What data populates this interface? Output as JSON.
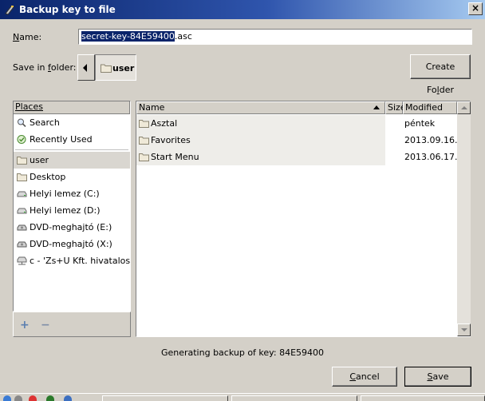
{
  "window": {
    "title": "Backup key to file",
    "close_glyph": "×"
  },
  "name_label_pre": "N",
  "name_label_post": "ame:",
  "filename": {
    "selected": "secret-key-84E59400",
    "extension": ".asc"
  },
  "save_in_label_pre": "Save in ",
  "save_in_label_u": "f",
  "save_in_label_post": "older:",
  "current_folder": "user",
  "create_folder": {
    "pre": "Create Fo",
    "u": "l",
    "post": "der"
  },
  "places": {
    "header": "Places",
    "items": [
      {
        "label": "Search",
        "icon": "search-icon"
      },
      {
        "label": "Recently Used",
        "icon": "recent-icon"
      },
      {
        "label": "user",
        "icon": "folder-icon"
      },
      {
        "label": "Desktop",
        "icon": "folder-icon"
      },
      {
        "label": "Helyi lemez (C:)",
        "icon": "drive-icon"
      },
      {
        "label": "Helyi lemez (D:)",
        "icon": "drive-icon"
      },
      {
        "label": "DVD-meghajtó (E:)",
        "icon": "dvd-icon"
      },
      {
        "label": "DVD-meghajtó (X:)",
        "icon": "dvd-icon"
      },
      {
        "label": "c - 'Zs+U Kft. hivatalos...",
        "icon": "network-drive-icon"
      }
    ],
    "add_glyph": "+",
    "remove_glyph": "−"
  },
  "files": {
    "columns": {
      "name": "Name",
      "size": "Size",
      "modified": "Modified"
    },
    "rows": [
      {
        "name": "Asztal",
        "modified": "péntek"
      },
      {
        "name": "Favorites",
        "modified": "2013.09.16."
      },
      {
        "name": "Start Menu",
        "modified": "2013.06.17."
      }
    ]
  },
  "status": "Generating backup of key: 84E59400",
  "cancel": {
    "u": "C",
    "post": "ancel"
  },
  "save": {
    "u": "S",
    "post": "ave"
  },
  "colors": {
    "title_bar": "#0a246a",
    "selection": "#0a246a",
    "dialog_bg": "#d4d0c8"
  }
}
